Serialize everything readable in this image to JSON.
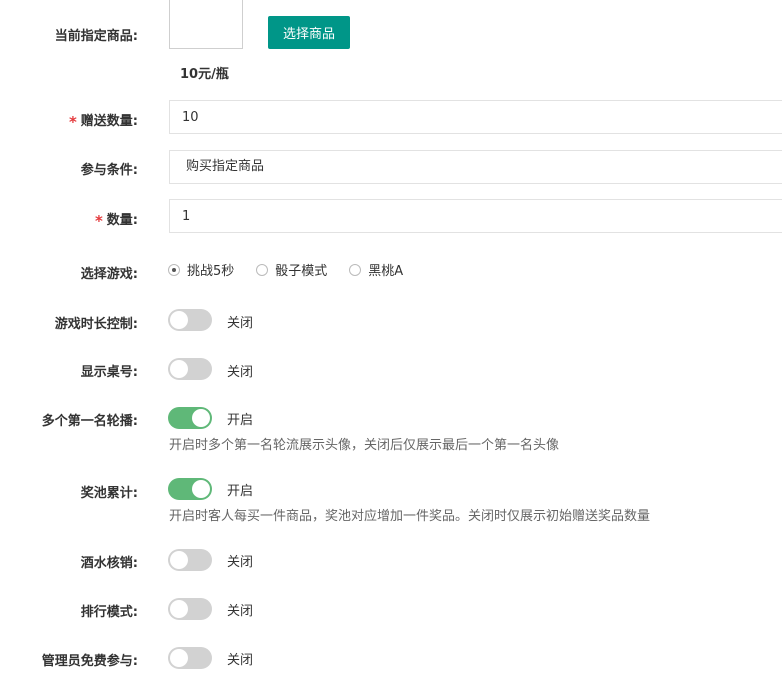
{
  "product": {
    "label": "当前指定商品:",
    "select_button": "选择商品",
    "price": "10元/瓶"
  },
  "gift_quantity": {
    "label": "赠送数量:",
    "value": "10",
    "required": true
  },
  "condition": {
    "label": "参与条件:",
    "value": "购买指定商品"
  },
  "quantity": {
    "label": "数量:",
    "value": "1",
    "required": true
  },
  "game": {
    "label": "选择游戏:",
    "options": [
      "挑战5秒",
      "骰子模式",
      "黑桃A"
    ],
    "selected": "挑战5秒"
  },
  "toggles": {
    "game_duration": {
      "label": "游戏时长控制:",
      "state": "关闭",
      "on": false
    },
    "show_table": {
      "label": "显示桌号:",
      "state": "关闭",
      "on": false
    },
    "multi_first": {
      "label": "多个第一名轮播:",
      "state": "开启",
      "on": true,
      "hint": "开启时多个第一名轮流展示头像，关闭后仅展示最后一个第一名头像"
    },
    "pool_accumulate": {
      "label": "奖池累计:",
      "state": "开启",
      "on": true,
      "hint": "开启时客人每买一件商品，奖池对应增加一件奖品。关闭时仅展示初始赠送奖品数量"
    },
    "drink_verify": {
      "label": "酒水核销:",
      "state": "关闭",
      "on": false
    },
    "ranking_mode": {
      "label": "排行模式:",
      "state": "关闭",
      "on": false
    },
    "admin_free": {
      "label": "管理员免费参与:",
      "state": "关闭",
      "on": false
    }
  },
  "colors": {
    "primary": "#009688",
    "switch_on": "#5fb878",
    "switch_off": "#d2d2d2",
    "required": "#e4393c"
  }
}
